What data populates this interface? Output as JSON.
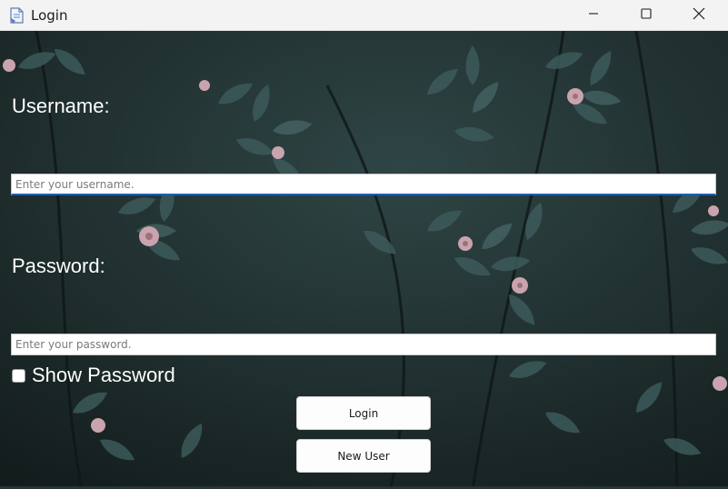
{
  "window": {
    "title": "Login",
    "icon": "app-icon",
    "controls": [
      "minimize-icon",
      "maximize-icon",
      "close-icon"
    ]
  },
  "form": {
    "username_label": "Username:",
    "username_placeholder": "Enter your username.",
    "username_value": "",
    "password_label": "Password:",
    "password_placeholder": "Enter your password.",
    "password_value": "",
    "show_password_label": "Show Password",
    "show_password_checked": false,
    "login_button": "Login",
    "new_user_button": "New User"
  },
  "colors": {
    "background_dark": "#1a2424",
    "leaf": "#3d5a5a",
    "flower": "#c9a3ad",
    "focus_accent": "#1f5fb0"
  }
}
